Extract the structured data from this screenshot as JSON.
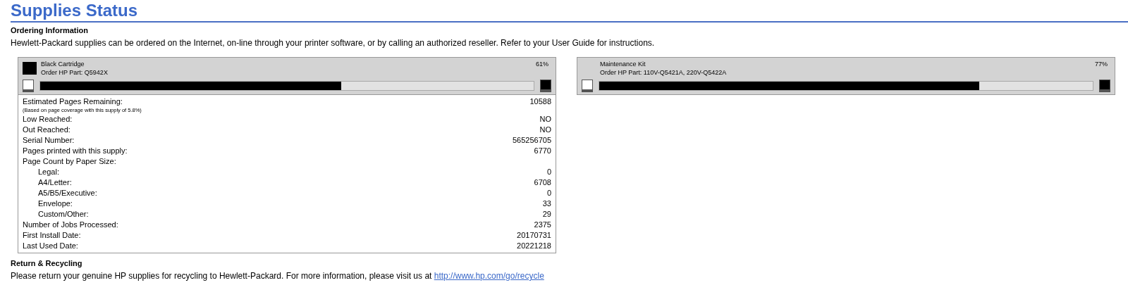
{
  "title": "Supplies Status",
  "ordering": {
    "heading": "Ordering Information",
    "text": "Hewlett-Packard supplies can be ordered on the Internet, on-line through your printer software, or by calling an authorized reseller. Refer to your User Guide for instructions."
  },
  "supplies": [
    {
      "name": "Black Cartridge",
      "part": "Order HP Part: Q5942X",
      "percent": "61%",
      "level": 0.61,
      "color": "#000000",
      "details": [
        {
          "label": "Estimated Pages Remaining:",
          "value": "10588"
        },
        {
          "label": "(Based on page coverage with this supply of 5.8%)",
          "kind": "note"
        },
        {
          "label": "Low Reached:",
          "value": "NO"
        },
        {
          "label": "Out Reached:",
          "value": "NO"
        },
        {
          "label": "Serial Number:",
          "value": "565256705"
        },
        {
          "label": "Pages printed with this supply:",
          "value": "6770"
        },
        {
          "label": "Page Count by Paper Size:",
          "children": [
            {
              "label": "Legal:",
              "value": "0"
            },
            {
              "label": "A4/Letter:",
              "value": "6708"
            },
            {
              "label": "A5/B5/Executive:",
              "value": "0"
            },
            {
              "label": "Envelope:",
              "value": "33"
            },
            {
              "label": "Custom/Other:",
              "value": "29"
            }
          ]
        },
        {
          "label": "Number of Jobs Processed:",
          "value": "2375"
        },
        {
          "label": "First Install Date:",
          "value": "20170731"
        },
        {
          "label": "Last Used Date:",
          "value": "20221218"
        }
      ]
    },
    {
      "name": "Maintenance Kit",
      "part": "Order HP Part: 110V-Q5421A, 220V-Q5422A",
      "percent": "77%",
      "level": 0.77
    }
  ],
  "recycling": {
    "heading": "Return & Recycling",
    "text": "Please return your genuine HP supplies for recycling to Hewlett-Packard. For more information, please visit us at",
    "link": "http://www.hp.com/go/recycle"
  }
}
